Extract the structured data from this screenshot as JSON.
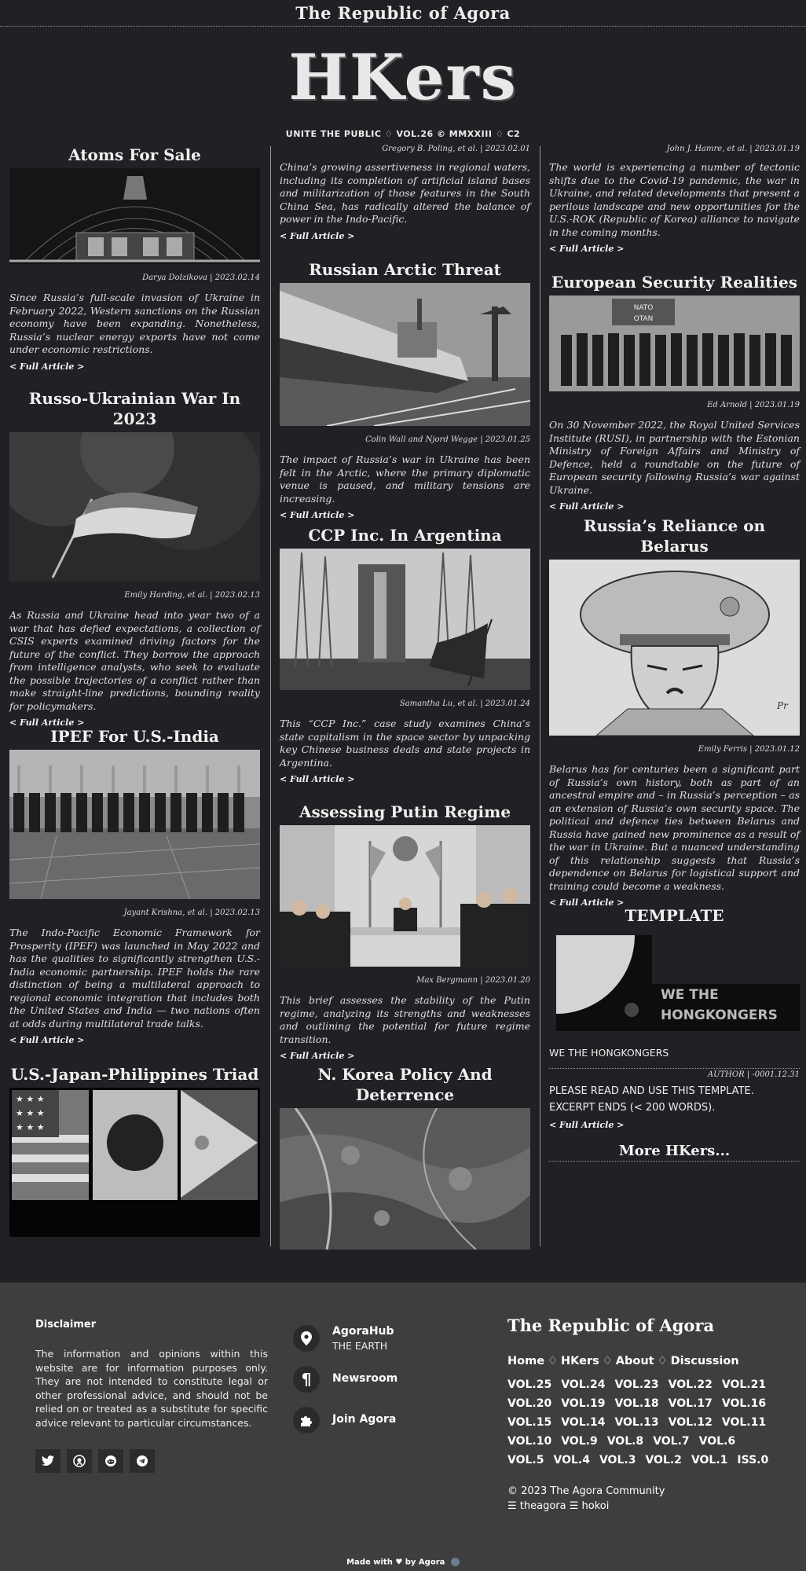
{
  "site": {
    "top_title": "The Republic of Agora",
    "logo": "HKers",
    "tagline": "UNITE THE PUBLIC ♢ VOL.26 © MMXXIII ♢ C2"
  },
  "articles": {
    "atoms": {
      "title": "Atoms For Sale",
      "byline": "Darya Dolzikova | 2023.02.14",
      "excerpt": "Since Russia’s full-scale invasion of Ukraine in February 2022, Western sanctions on the Russian economy have been expanding. Nonetheless, Russia’s nuclear energy exports have not come under economic restrictions.",
      "more": "< Full Article >"
    },
    "russo": {
      "title": "Russo-Ukrainian War In 2023",
      "byline": "Emily Harding, et al. | 2023.02.13",
      "excerpt": "As Russia and Ukraine head into year two of a war that has defied expectations, a collection of CSIS experts examined driving factors for the future of the conflict. They borrow the approach from intelligence analysts, who seek to evaluate the possible trajectories of a conflict rather than make straight-line predictions, bounding reality for policymakers.",
      "more": "< Full Article >"
    },
    "ipef": {
      "title": "IPEF For U.S.-India",
      "byline": "Jayant Krishna, et al. | 2023.02.13",
      "excerpt": "The Indo-Pacific Economic Framework for Prosperity (IPEF) was launched in May 2022 and has the qualities to significantly strengthen U.S.-India economic partnership. IPEF holds the rare distinction of being a multilateral approach to regional economic integration that includes both the United States and India — two nations often at odds during multilateral trade talks.",
      "more": "< Full Article >"
    },
    "triad": {
      "title": "U.S.-Japan-Philippines Triad"
    },
    "scs": {
      "byline": "Gregory B. Poling, et al. | 2023.02.01",
      "excerpt": "China’s growing assertiveness in regional waters, including its completion of artificial island bases and militarization of those features in the South China Sea, has radically altered the balance of power in the Indo-Pacific.",
      "more": "< Full Article >"
    },
    "arctic": {
      "title": "Russian Arctic Threat",
      "byline": "Colin Wall and Njord Wegge | 2023.01.25",
      "excerpt": "The impact of Russia’s war in Ukraine has been felt in the Arctic, where the primary diplomatic venue is paused, and military tensions are increasing.",
      "more": "< Full Article >"
    },
    "ccp": {
      "title": "CCP Inc. In Argentina",
      "byline": "Samantha Lu, et al. | 2023.01.24",
      "excerpt": "This “CCP Inc.” case study examines China’s state capitalism in the space sector by unpacking key Chinese business deals and state projects in Argentina.",
      "more": "< Full Article >"
    },
    "putin": {
      "title": "Assessing Putin Regime",
      "byline": "Max Bergmann | 2023.01.20",
      "excerpt": "This brief assesses the stability of the Putin regime, analyzing its strengths and weaknesses and outlining the potential for future regime transition.",
      "more": "< Full Article >"
    },
    "korea": {
      "title": "N. Korea Policy And Deterrence"
    },
    "rok": {
      "byline": "John J. Hamre, et al. | 2023.01.19",
      "excerpt": "The world is experiencing a number of tectonic shifts due to the Covid-19 pandemic, the war in Ukraine, and related developments that present a perilous landscape and new opportunities for the U.S.-ROK (Republic of Korea) alliance to navigate in the coming months.",
      "more": "< Full Article >"
    },
    "europe": {
      "title": "European Security Realities",
      "byline": "Ed Arnold | 2023.01.19",
      "excerpt": "On 30 November 2022, the Royal United Services Institute (RUSI), in partnership with the Estonian Ministry of Foreign Affairs and Ministry of Defence, held a roundtable on the future of European security following Russia’s war against Ukraine.",
      "more": "< Full Article >",
      "sign1": "NATO",
      "sign2": "OTAN"
    },
    "belarus": {
      "title": "Russia’s Reliance on Belarus",
      "byline": "Emily Ferris | 2023.01.12",
      "excerpt": "Belarus has for centuries been a significant part of Russia’s own history, both as part of an ancestral empire and – in Russia’s perception – as an extension of Russia’s own security space. The political and defence ties between Belarus and Russia have gained new prominence as a result of the war in Ukraine. But a nuanced understanding of this relationship suggests that Russia’s dependence on Belarus for logistical support and training could become a weakness.",
      "more": "< Full Article >"
    },
    "template": {
      "title": "TEMPLATE",
      "logo_line1": "WE THE",
      "logo_line2": "HONGKONGERS",
      "subtitle": "WE THE HONGKONGERS",
      "byline": "AUTHOR | -0001.12.31",
      "line1": "PLEASE READ AND USE THIS TEMPLATE.",
      "line2": "EXCERPT ENDS (< 200 WORDS).",
      "more": "< Full Article >"
    },
    "more_hkers": "More HKers..."
  },
  "footer": {
    "disclaimer_title": "Disclaimer",
    "disclaimer_text": "The information and opinions within this website are for information purposes only. They are not intended to constitute legal or other professional advice, and should not be relied on or treated as a substitute for specific advice relevant to particular circumstances.",
    "social_icons": [
      "twitter-icon",
      "github-icon",
      "reddit-icon",
      "telegram-icon"
    ],
    "contacts": [
      {
        "label": "AgoraHub",
        "sub": "THE EARTH",
        "icon": "map-pin-icon"
      },
      {
        "label": "Newsroom",
        "icon": "pilcrow-icon"
      },
      {
        "label": "Join Agora",
        "icon": "puzzle-icon"
      }
    ],
    "brand": "The Republic of Agora",
    "nav": [
      "Home",
      "HKers",
      "About",
      "Discussion"
    ],
    "nav_sep": "♢",
    "volumes": [
      "VOL.25",
      "VOL.24",
      "VOL.23",
      "VOL.22",
      "VOL.21",
      "VOL.20",
      "VOL.19",
      "VOL.18",
      "VOL.17",
      "VOL.16",
      "VOL.15",
      "VOL.14",
      "VOL.13",
      "VOL.12",
      "VOL.11",
      "VOL.10",
      "VOL.9",
      "VOL.8",
      "VOL.7",
      "VOL.6",
      "VOL.5",
      "VOL.4",
      "VOL.3",
      "VOL.2",
      "VOL.1",
      "ISS.0"
    ],
    "copyright": "© 2023 The Agora Community",
    "handles": "☰ theagora ☰ hokoi",
    "made_with_prefix": "Made with",
    "made_with_suffix": "by Agora"
  }
}
